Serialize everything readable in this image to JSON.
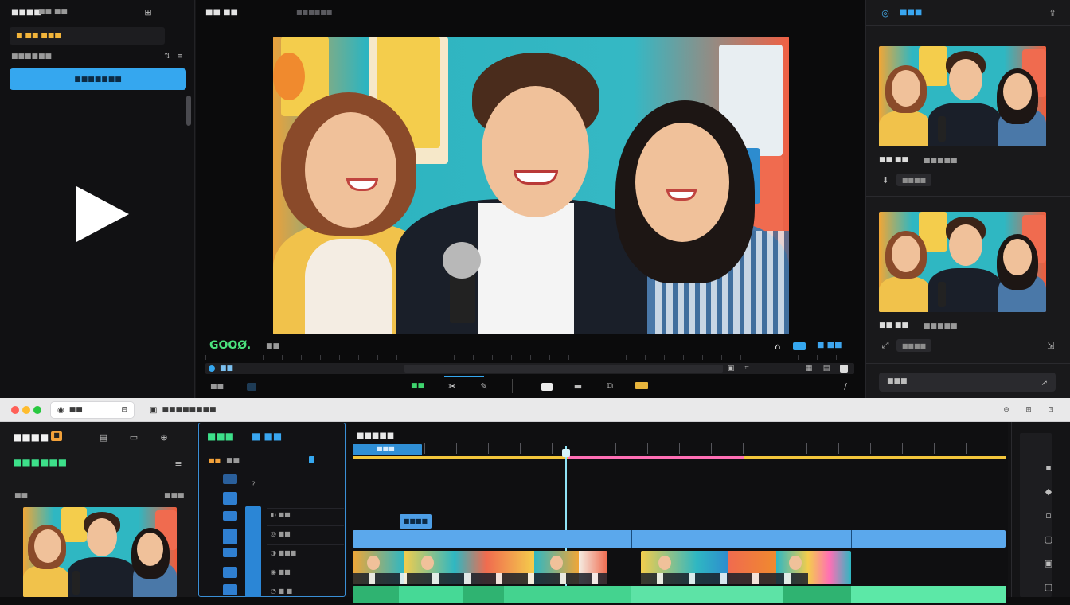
{
  "top": {
    "left_panel": {
      "header_label": "■■■■",
      "header_sub": "■■ ■■",
      "search_value": "■ ■■ ■■■",
      "section_label": "■■■■■■",
      "primary_button": "■■■■■■■"
    },
    "preview": {
      "title": "■■ ■■",
      "subtitle": "■■■■■■",
      "timecode": "GOOØ.",
      "timecode_suffix": "■■",
      "right_readout": "■ ■■",
      "scrub_label": "■■",
      "toolbar_green": "■■"
    },
    "right_panel": {
      "title": "■■■",
      "thumb1_label": "■■ ■■",
      "thumb1_meta": "■■■■■",
      "thumb1_chip": "■■■■",
      "thumb2_label": "■■ ■■",
      "thumb2_meta": "■■■■■",
      "thumb2_chip": "■■■■",
      "bottom_input": "■■■"
    }
  },
  "bottom": {
    "tab1": "■■",
    "tab2": "■■■■■■■■",
    "media": {
      "title": "■■■■",
      "title_badge": "■",
      "subtitle": "■■■■■■",
      "section": "■■",
      "section_right": "■■■"
    },
    "effects": {
      "title": "■■■",
      "title_blue": "■ ■■",
      "tab_a": "■■",
      "tab_b": "■■"
    },
    "timeline": {
      "title": "■■■■■",
      "marker": "■■■",
      "clip_tag": "■■■■"
    }
  },
  "colors": {
    "accent_blue": "#35a7ef",
    "accent_green": "#3de08a",
    "playhead": "#8fe3f5",
    "marker_pink": "#ff6fb5",
    "marker_yellow": "#f3c63c"
  },
  "icons": [
    "play-icon",
    "sidebar-icon",
    "settings-icon",
    "share-icon",
    "zoom-icon",
    "flag-icon",
    "lock-icon",
    "menu-icon"
  ]
}
